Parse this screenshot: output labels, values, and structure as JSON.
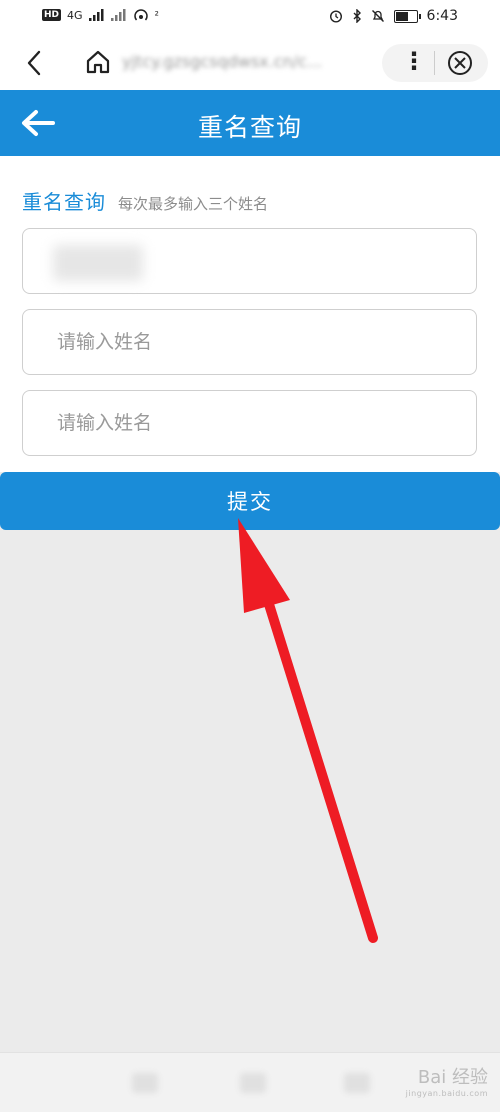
{
  "status_bar": {
    "hd_badge": "HD",
    "network": "4G",
    "signal_extra": "²",
    "time": "6:43"
  },
  "browser": {
    "url": "yjtcy.gzsgcsqdwsx.cn/c..."
  },
  "app": {
    "title": "重名查询"
  },
  "form": {
    "section_title": "重名查询",
    "hint": "每次最多输入三个姓名",
    "field_placeholder": "请输入姓名",
    "fields": [
      {
        "value": "",
        "placeholder": "请输入姓名",
        "blurred": true
      },
      {
        "value": "",
        "placeholder": "请输入姓名"
      },
      {
        "value": "",
        "placeholder": "请输入姓名"
      }
    ],
    "submit_label": "提交"
  },
  "watermark": {
    "text": "Bai 经验",
    "sub": "jingyan.baidu.com"
  },
  "colors": {
    "accent": "#1a8cd8",
    "annotation": "#ee1c24"
  }
}
